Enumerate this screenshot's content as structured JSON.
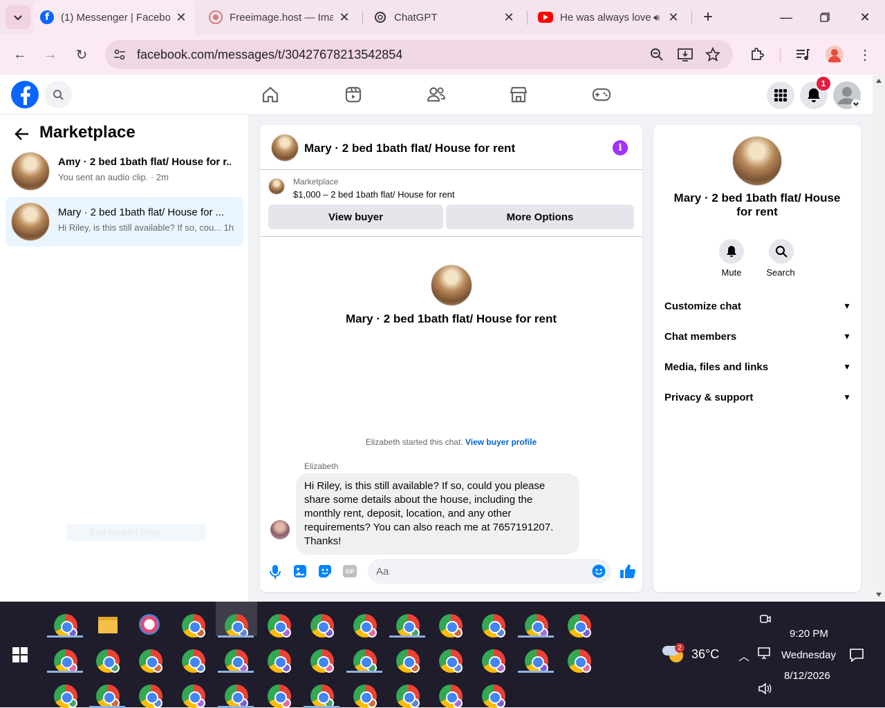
{
  "browser": {
    "tabs": [
      {
        "title": "(1) Messenger | Facebo",
        "active": true
      },
      {
        "title": "Freeimage.host — Ima",
        "active": false
      },
      {
        "title": "ChatGPT",
        "active": false
      },
      {
        "title": "He was always love",
        "active": false
      }
    ],
    "url": "facebook.com/messages/t/30427678213542854"
  },
  "fb_header": {
    "notification_count": "1"
  },
  "left_pane": {
    "title": "Marketplace",
    "conversations": [
      {
        "name": "Amy · 2 bed 1bath flat/ House for r...",
        "preview": "You sent an audio clip. · 2m",
        "selected": false
      },
      {
        "name": "Mary · 2 bed 1bath flat/ House for ...",
        "preview": "Hi Riley, is this still available? If so, cou... 1h",
        "selected": true
      }
    ],
    "ghost_text": "Full-screen Snip"
  },
  "chat": {
    "header_title": "Mary · 2 bed 1bath flat/ House for rent",
    "listing_label": "Marketplace",
    "listing_text": "$1,000 – 2 bed 1bath flat/ House for rent",
    "view_buyer": "View buyer",
    "more_options": "More Options",
    "intro_title": "Mary · 2 bed 1bath flat/ House for rent",
    "started_text": "Elizabeth started this chat.",
    "view_buyer_profile": "View buyer profile",
    "sender": "Elizabeth",
    "message": "Hi Riley, is this still available? If so, could you please share some details about the house, including the monthly rent, deposit, location, and any other requirements? You can also reach me at 7657191207. Thanks!",
    "composer_placeholder": "Aa"
  },
  "info_panel": {
    "title": "Mary · 2 bed 1bath flat/ House for rent",
    "mute": "Mute",
    "search": "Search",
    "sections": [
      "Customize chat",
      "Chat members",
      "Media, files and links",
      "Privacy & support"
    ]
  },
  "taskbar": {
    "temperature": "36°C",
    "weather_badge": "2",
    "time": "9:20 PM",
    "day": "Wednesday",
    "date": "8/12/2026"
  },
  "colors": {
    "fb_blue": "#0866ff",
    "messenger_accent": "#0084ff",
    "info_purple": "#a033ff"
  }
}
